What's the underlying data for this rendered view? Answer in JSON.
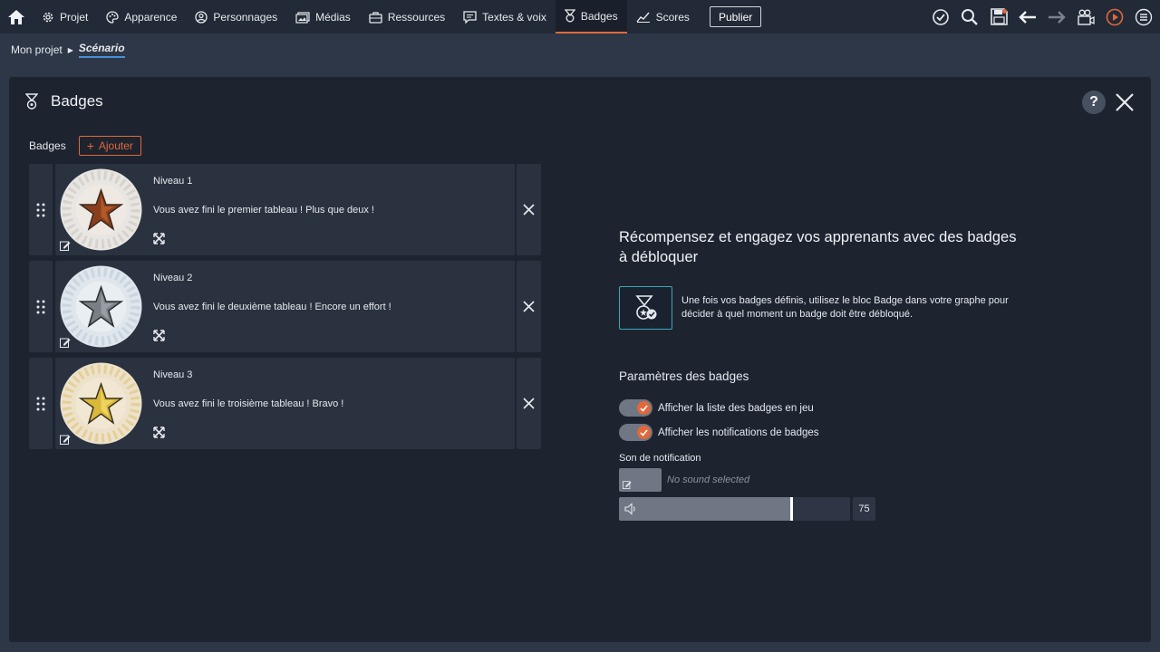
{
  "topbar": {
    "home_icon": "home-icon",
    "nav": [
      {
        "label": "Projet",
        "icon": "gear-icon"
      },
      {
        "label": "Apparence",
        "icon": "palette-icon"
      },
      {
        "label": "Personnages",
        "icon": "person-icon"
      },
      {
        "label": "Médias",
        "icon": "media-icon"
      },
      {
        "label": "Ressources",
        "icon": "briefcase-icon"
      },
      {
        "label": "Textes & voix",
        "icon": "chat-icon"
      },
      {
        "label": "Badges",
        "icon": "medal-icon",
        "active": true
      },
      {
        "label": "Scores",
        "icon": "chart-icon"
      }
    ],
    "publish_label": "Publier",
    "accent_color": "#e0683a"
  },
  "breadcrumb": {
    "root": "Mon projet",
    "current": "Scénario"
  },
  "panel": {
    "title": "Badges",
    "help_label": "?",
    "list_label": "Badges",
    "add_label": "Ajouter",
    "badges": [
      {
        "name": "Niveau 1",
        "description": "Vous avez fini le premier tableau ! Plus que deux !",
        "star_color": "#8a3f1c"
      },
      {
        "name": "Niveau 2",
        "description": "Vous avez fini le deuxième tableau ! Encore un effort !",
        "star_color": "#7a7f86"
      },
      {
        "name": "Niveau 3",
        "description": "Vous avez fini le troisième tableau ! Bravo !",
        "star_color": "#d9b83a"
      }
    ],
    "promo_title": "Récompensez et engagez vos apprenants avec des badges à débloquer",
    "info_text": "Une fois vos badges définis, utilisez le bloc Badge dans votre graphe pour décider à quel moment un badge doit être débloqué.",
    "settings_title": "Paramètres des badges",
    "toggles": [
      {
        "label": "Afficher la liste des badges en jeu",
        "on": true
      },
      {
        "label": "Afficher les notifications de badges",
        "on": true
      }
    ],
    "sound_label": "Son de notification",
    "sound_value": "No sound selected",
    "volume": 75
  }
}
